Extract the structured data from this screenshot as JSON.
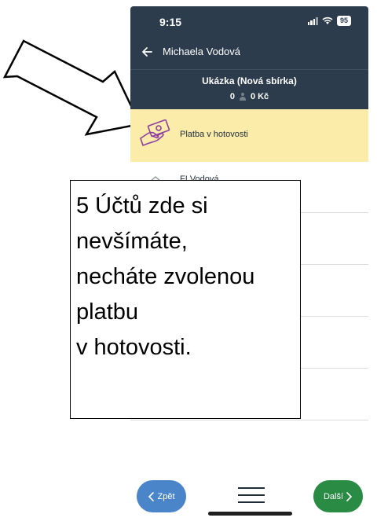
{
  "status_bar": {
    "time": "9:15",
    "battery": "95"
  },
  "header": {
    "title": "Michaela Vodová"
  },
  "collection": {
    "title": "Ukázka (Nová sbírka)",
    "count": "0",
    "amount": "0 Kč"
  },
  "payments": {
    "selected_label": "Platba v hotovosti",
    "next_label_partial": "FI Vodová"
  },
  "note": {
    "lines": [
      "5 Účtů zde si",
      "nevšímáte,",
      "necháte zvolenou",
      "platbu",
      "v hotovosti."
    ]
  },
  "footer": {
    "back_label": "Zpět",
    "next_label": "Další"
  },
  "colors": {
    "header_bg": "#2c3c4c",
    "selected_bg": "#fcecaa",
    "back_button": "#4a84c9",
    "next_button": "#2a8b45",
    "icon_purple": "#8b3fa3"
  },
  "icons": [
    "signal-icon",
    "wifi-icon",
    "back-arrow-icon",
    "person-icon",
    "cash-payment-icon",
    "bank-icon",
    "chevron-left-icon",
    "chevron-right-icon",
    "menu-icon"
  ]
}
